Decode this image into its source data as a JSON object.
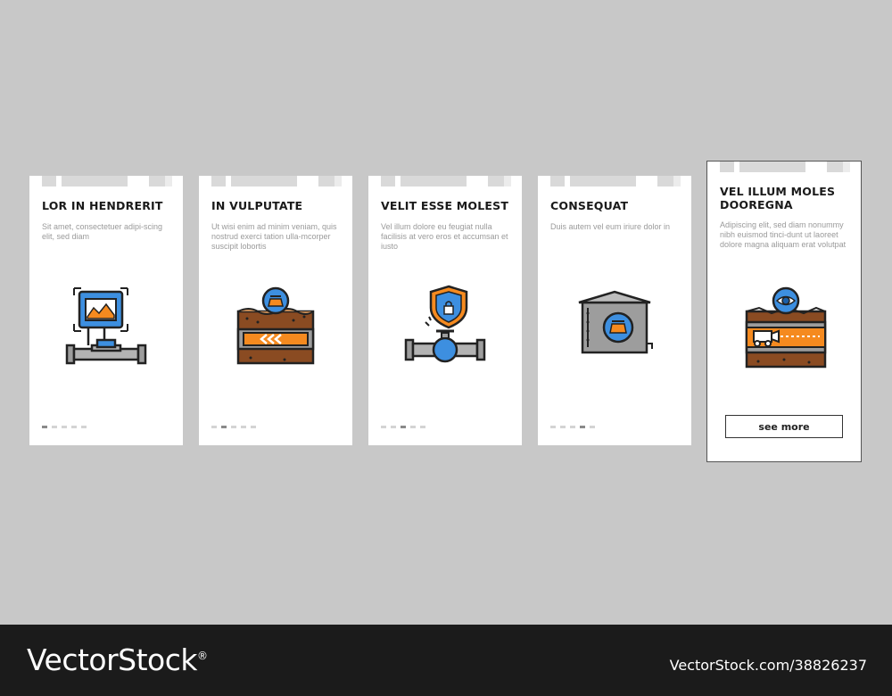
{
  "colors": {
    "background": "#c8c8c8",
    "card": "#ffffff",
    "accent_blue": "#3d8fe0",
    "accent_orange": "#f58a1f",
    "soil_brown": "#8a4b22",
    "pipe_gray": "#9d9d9d",
    "footer": "#1b1b1b"
  },
  "cards": [
    {
      "title": "LOR IN HENDRERIT",
      "description": "Sit amet, consectetuer adipi-scing elit, sed diam",
      "icon": "pipeline-monitor-icon",
      "active_dot": 0
    },
    {
      "title": "IN VULPUTATE",
      "description": "Ut wisi enim ad minim veniam, quis nostrud exerci tation ulla-mcorper suscipit lobortis",
      "icon": "underground-pipe-oil-icon",
      "active_dot": 1
    },
    {
      "title": "VELIT ESSE MOLEST",
      "description": "Vel illum dolore eu feugiat nulla facilisis at vero eros et accumsan et iusto",
      "icon": "pipe-valve-security-icon",
      "active_dot": 2
    },
    {
      "title": "CONSEQUAT",
      "description": "Duis autem vel eum iriure dolor in",
      "icon": "oil-storage-tank-icon",
      "active_dot": 3
    },
    {
      "title": "VEL ILLUM MOLES DOOREGNA",
      "description": "Adipiscing elit, sed diam nonummy nibh euismod tinci-dunt ut laoreet dolore magna aliquam erat volutpat",
      "icon": "pipeline-inspection-robot-icon",
      "button": "see more"
    }
  ],
  "footer": {
    "brand": "VectorStock",
    "trademark": "®",
    "image_id": "VectorStock.com/38826237"
  }
}
